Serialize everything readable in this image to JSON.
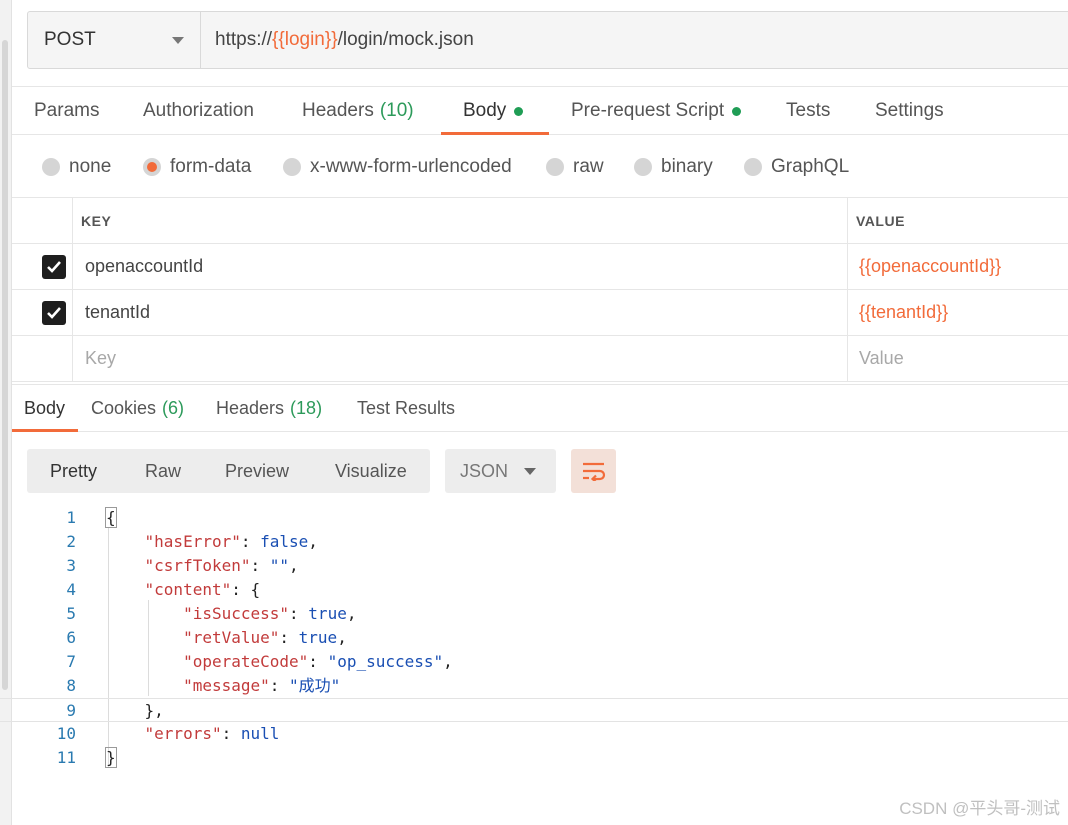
{
  "request": {
    "method": "POST",
    "url_prefix": "https://",
    "url_var": "{{login}}",
    "url_suffix": "/login/mock.json"
  },
  "request_tabs": [
    {
      "label": "Params"
    },
    {
      "label": "Authorization"
    },
    {
      "label": "Headers",
      "count": "(10)"
    },
    {
      "label": "Body",
      "active": true,
      "dot": true
    },
    {
      "label": "Pre-request Script",
      "dot": true
    },
    {
      "label": "Tests"
    },
    {
      "label": "Settings"
    }
  ],
  "body_types": [
    {
      "label": "none"
    },
    {
      "label": "form-data",
      "selected": true
    },
    {
      "label": "x-www-form-urlencoded"
    },
    {
      "label": "raw"
    },
    {
      "label": "binary"
    },
    {
      "label": "GraphQL"
    }
  ],
  "params_table": {
    "headers": {
      "key": "KEY",
      "value": "VALUE"
    },
    "rows": [
      {
        "checked": true,
        "key": "openaccountId",
        "value": "{{openaccountId}}"
      },
      {
        "checked": true,
        "key": "tenantId",
        "value": "{{tenantId}}"
      }
    ],
    "placeholder": {
      "key": "Key",
      "value": "Value"
    }
  },
  "response_tabs": [
    {
      "label": "Body",
      "active": true
    },
    {
      "label": "Cookies",
      "count": "(6)"
    },
    {
      "label": "Headers",
      "count": "(18)"
    },
    {
      "label": "Test Results"
    }
  ],
  "view_modes": [
    "Pretty",
    "Raw",
    "Preview",
    "Visualize"
  ],
  "format": "JSON",
  "code_lines": [
    "1",
    "2",
    "3",
    "4",
    "5",
    "6",
    "7",
    "8",
    "9",
    "10",
    "11"
  ],
  "json": {
    "open": "{",
    "hasError_key": "\"hasError\"",
    "hasError_val": "false",
    "csrfToken_key": "\"csrfToken\"",
    "csrfToken_val": "\"\"",
    "content_key": "\"content\"",
    "content_open": "{",
    "isSuccess_key": "\"isSuccess\"",
    "isSuccess_val": "true",
    "retValue_key": "\"retValue\"",
    "retValue_val": "true",
    "operateCode_key": "\"operateCode\"",
    "operateCode_val": "\"op_success\"",
    "message_key": "\"message\"",
    "message_val": "\"成功\"",
    "content_close": "},",
    "errors_key": "\"errors\"",
    "errors_val": "null",
    "close": "}"
  },
  "watermark": "CSDN @平头哥-测试",
  "colors": {
    "accent": "#f26b3a",
    "green": "#1f9d55",
    "blue_value": "#1a4fb3",
    "key_red": "#c23b3b"
  }
}
